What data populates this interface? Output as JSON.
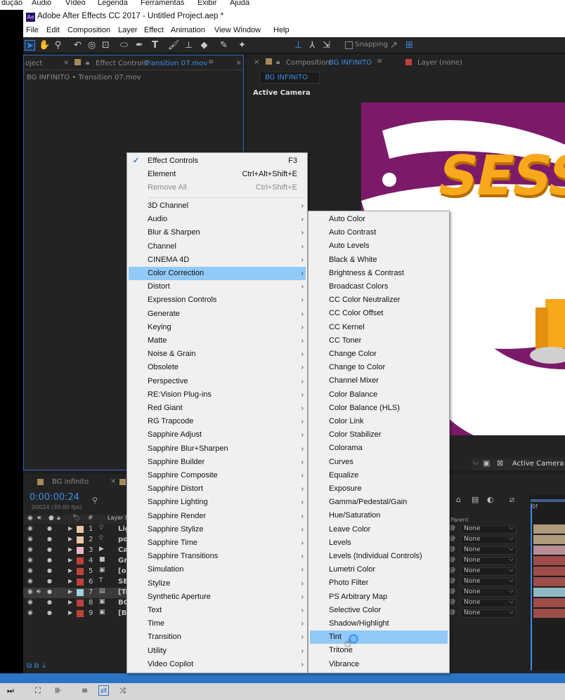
{
  "os_menu": [
    "dução",
    "Áudio",
    "Vídeo",
    "Legenda",
    "Ferramentas",
    "Exibir",
    "Ajuda"
  ],
  "window_title": "Adobe After Effects CC 2017 - Untitled Project.aep *",
  "app_menu": [
    "File",
    "Edit",
    "Composition",
    "Layer",
    "Effect",
    "Animation",
    "View",
    "Window",
    "Help"
  ],
  "toolbar": {
    "snapping": "Snapping"
  },
  "project_tab": "oject",
  "effect_controls": {
    "tab_label": "Effect Controls",
    "tab_link": "Transition 07.mov",
    "breadcrumb": "BG INFINITO • Transition 07.mov"
  },
  "composition": {
    "tab_label": "Composition",
    "tab_link": "BG INFINITO",
    "layer_tab": "Layer (none)",
    "sub_tab": "BG INFINITO",
    "view_label": "Active Camera",
    "view_dropdown": "Active Camera",
    "artwork_text": "SESS"
  },
  "timeline": {
    "tab": "BG infinito",
    "timecode": "0:00:00:24",
    "fps": "00024 (30.00 fps)",
    "col_num": "#",
    "col_layer": "Layer N",
    "parent_header": "Parent",
    "time_marker": "0f",
    "layers": [
      {
        "num": "1",
        "name": "Lig",
        "color": "#e9c5a0",
        "icon": "light"
      },
      {
        "num": "2",
        "name": "po",
        "color": "#e9c5a0",
        "icon": "light"
      },
      {
        "num": "3",
        "name": "Ca",
        "color": "#e8b8c0",
        "icon": "camera"
      },
      {
        "num": "4",
        "name": "Gr",
        "color": "#c0403a",
        "icon": "solid"
      },
      {
        "num": "5",
        "name": "[ol",
        "color": "#c0403a",
        "icon": "comp"
      },
      {
        "num": "6",
        "name": "SE",
        "color": "#c0403a",
        "icon": "text"
      },
      {
        "num": "7",
        "name": "[Tr",
        "color": "#9fd3e0",
        "icon": "footage"
      },
      {
        "num": "8",
        "name": "BG",
        "color": "#c0403a",
        "icon": "comp"
      },
      {
        "num": "9",
        "name": "[B",
        "color": "#c0403a",
        "icon": "comp"
      }
    ],
    "parent_value": "None"
  },
  "effect_menu": {
    "top": [
      {
        "label": "Effect Controls",
        "shortcut": "F3",
        "checked": true
      },
      {
        "label": "Element",
        "shortcut": "Ctrl+Alt+Shift+E"
      },
      {
        "label": "Remove All",
        "shortcut": "Ctrl+Shift+E",
        "disabled": true
      }
    ],
    "items": [
      "3D Channel",
      "Audio",
      "Blur & Sharpen",
      "Channel",
      "CINEMA 4D",
      "Color Correction",
      "Distort",
      "Expression Controls",
      "Generate",
      "Keying",
      "Matte",
      "Noise & Grain",
      "Obsolete",
      "Perspective",
      "RE:Vision Plug-ins",
      "Red Giant",
      "RG Trapcode",
      "Sapphire Adjust",
      "Sapphire Blur+Sharpen",
      "Sapphire Builder",
      "Sapphire Composite",
      "Sapphire Distort",
      "Sapphire Lighting",
      "Sapphire Render",
      "Sapphire Stylize",
      "Sapphire Time",
      "Sapphire Transitions",
      "Simulation",
      "Stylize",
      "Synthetic Aperture",
      "Text",
      "Time",
      "Transition",
      "Utility",
      "Video Copilot"
    ],
    "highlighted": "Color Correction"
  },
  "color_correction_menu": {
    "items": [
      "Auto Color",
      "Auto Contrast",
      "Auto Levels",
      "Black & White",
      "Brightness & Contrast",
      "Broadcast Colors",
      "CC Color Neutralizer",
      "CC Color Offset",
      "CC Kernel",
      "CC Toner",
      "Change Color",
      "Change to Color",
      "Channel Mixer",
      "Color Balance",
      "Color Balance (HLS)",
      "Color Link",
      "Color Stabilizer",
      "Colorama",
      "Curves",
      "Equalize",
      "Exposure",
      "Gamma/Pedestal/Gain",
      "Hue/Saturation",
      "Leave Color",
      "Levels",
      "Levels (Individual Controls)",
      "Lumetri Color",
      "Photo Filter",
      "PS Arbitrary Map",
      "Selective Color",
      "Shadow/Highlight",
      "Tint",
      "Tritone",
      "Vibrance"
    ],
    "highlighted": "Tint"
  },
  "colors": {
    "menu_highlight": "#91c9f7",
    "panel_focus": "#2d6bb6",
    "ae_blue_text": "#3d8ee6",
    "artwork_purple": "#7c1a6a",
    "artwork_orange": "#f7a81b"
  }
}
